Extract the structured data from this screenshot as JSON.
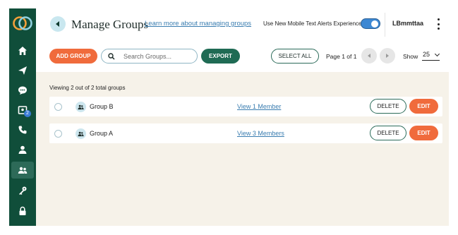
{
  "header": {
    "title": "Manage Groups",
    "learn_more": "Learn more about managing groups",
    "toggle_label": "Use New Mobile Text Alerts Experience",
    "toggle_on": true,
    "user_name": "LBmmttaa"
  },
  "sidebar": {
    "items": [
      {
        "icon": "home-icon"
      },
      {
        "icon": "send-icon"
      },
      {
        "icon": "chat-icon"
      },
      {
        "icon": "inbox-icon",
        "badge": "2"
      },
      {
        "icon": "phone-icon"
      },
      {
        "icon": "contact-icon"
      },
      {
        "icon": "groups-icon",
        "active": true
      },
      {
        "icon": "key-icon"
      },
      {
        "icon": "lock-icon"
      }
    ]
  },
  "toolbar": {
    "add_group": "ADD GROUP",
    "search_placeholder": "Search Groups...",
    "export": "EXPORT",
    "select_all": "SELECT ALL",
    "page_info": "Page 1 of 1",
    "show_label": "Show",
    "show_value": "25"
  },
  "main": {
    "viewing_text": "Viewing 2 out of 2 total groups",
    "groups": [
      {
        "name": "Group B",
        "members": "View 1 Member",
        "delete": "DELETE",
        "edit": "EDIT"
      },
      {
        "name": "Group A",
        "members": "View 3 Members",
        "delete": "DELETE",
        "edit": "EDIT"
      }
    ]
  },
  "colors": {
    "sidebar": "#104e3a",
    "accent_orange": "#f06b3c",
    "accent_green": "#1f6b54",
    "link_blue": "#3a7db0",
    "content_bg": "#f6f2e9"
  }
}
